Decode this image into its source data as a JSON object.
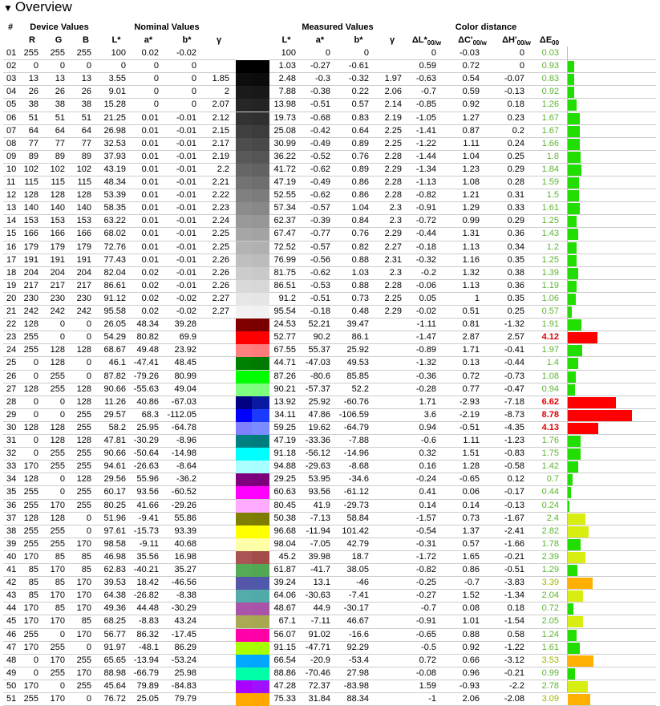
{
  "section": {
    "title": "Overview",
    "arrow": "▼"
  },
  "headers": {
    "index": "#",
    "device_values": "Device Values",
    "nominal_values": "Nominal Values",
    "measured_values": "Measured Values",
    "color_distance": "Color distance",
    "R": "R",
    "G": "G",
    "B": "B",
    "L": "L*",
    "a": "a*",
    "b": "b*",
    "gamma": "γ",
    "dL": "ΔL*",
    "dL_sub": "00/w",
    "dC": "ΔC'",
    "dC_sub": "00/w",
    "dH": "ΔH'",
    "dH_sub": "00/w",
    "dE": "ΔE",
    "dE_sub": "00"
  },
  "colors": {
    "de_green": "#5cb531",
    "de_yellow": "#a3b500",
    "de_red": "#e00000",
    "grid": "#cccccc"
  },
  "rows": [
    [
      "01",
      "255",
      "255",
      "255",
      "100",
      "0.02",
      "-0.02",
      "",
      "100",
      "0",
      "0",
      "",
      "0",
      "-0.03",
      "0",
      "0.03",
      "#ffffff",
      "#ffffff"
    ],
    [
      "02",
      "0",
      "0",
      "0",
      "0",
      "0",
      "0",
      "",
      "1.03",
      "-0.27",
      "-0.61",
      "",
      "0.59",
      "0.72",
      "0",
      "0.93",
      "#000000",
      "#000000"
    ],
    [
      "03",
      "13",
      "13",
      "13",
      "3.55",
      "0",
      "0",
      "1.85",
      "2.48",
      "-0.3",
      "-0.32",
      "1.97",
      "-0.63",
      "0.54",
      "-0.07",
      "0.83",
      "#0d0d0d",
      "#0b0b0b"
    ],
    [
      "04",
      "26",
      "26",
      "26",
      "9.01",
      "0",
      "0",
      "2",
      "7.88",
      "-0.38",
      "0.22",
      "2.06",
      "-0.7",
      "0.59",
      "-0.13",
      "0.92",
      "#1a1a1a",
      "#181818"
    ],
    [
      "05",
      "38",
      "38",
      "38",
      "15.28",
      "0",
      "0",
      "2.07",
      "13.98",
      "-0.51",
      "0.57",
      "2.14",
      "-0.85",
      "0.92",
      "0.18",
      "1.26",
      "#262626",
      "#232323"
    ],
    [
      "06",
      "51",
      "51",
      "51",
      "21.25",
      "0.01",
      "-0.01",
      "2.12",
      "19.73",
      "-0.68",
      "0.83",
      "2.19",
      "-1.05",
      "1.27",
      "0.23",
      "1.67",
      "#333333",
      "#303030"
    ],
    [
      "07",
      "64",
      "64",
      "64",
      "26.98",
      "0.01",
      "-0.01",
      "2.15",
      "25.08",
      "-0.42",
      "0.64",
      "2.25",
      "-1.41",
      "0.87",
      "0.2",
      "1.67",
      "#404040",
      "#3c3c3c"
    ],
    [
      "08",
      "77",
      "77",
      "77",
      "32.53",
      "0.01",
      "-0.01",
      "2.17",
      "30.99",
      "-0.49",
      "0.89",
      "2.25",
      "-1.22",
      "1.11",
      "0.24",
      "1.66",
      "#4d4d4d",
      "#494949"
    ],
    [
      "09",
      "89",
      "89",
      "89",
      "37.93",
      "0.01",
      "-0.01",
      "2.19",
      "36.22",
      "-0.52",
      "0.76",
      "2.28",
      "-1.44",
      "1.04",
      "0.25",
      "1.8",
      "#595959",
      "#555555"
    ],
    [
      "10",
      "102",
      "102",
      "102",
      "43.19",
      "0.01",
      "-0.01",
      "2.2",
      "41.72",
      "-0.62",
      "0.89",
      "2.29",
      "-1.34",
      "1.23",
      "0.29",
      "1.84",
      "#666666",
      "#626262"
    ],
    [
      "11",
      "115",
      "115",
      "115",
      "48.34",
      "0.01",
      "-0.01",
      "2.21",
      "47.19",
      "-0.49",
      "0.86",
      "2.28",
      "-1.13",
      "1.08",
      "0.28",
      "1.59",
      "#737373",
      "#6f6f6f"
    ],
    [
      "12",
      "128",
      "128",
      "128",
      "53.39",
      "0.01",
      "-0.01",
      "2.22",
      "52.55",
      "-0.62",
      "0.86",
      "2.28",
      "-0.82",
      "1.21",
      "0.31",
      "1.5",
      "#808080",
      "#7c7c7c"
    ],
    [
      "13",
      "140",
      "140",
      "140",
      "58.35",
      "0.01",
      "-0.01",
      "2.23",
      "57.34",
      "-0.57",
      "1.04",
      "2.3",
      "-0.91",
      "1.29",
      "0.33",
      "1.61",
      "#8c8c8c",
      "#888888"
    ],
    [
      "14",
      "153",
      "153",
      "153",
      "63.22",
      "0.01",
      "-0.01",
      "2.24",
      "62.37",
      "-0.39",
      "0.84",
      "2.3",
      "-0.72",
      "0.99",
      "0.29",
      "1.25",
      "#999999",
      "#969696"
    ],
    [
      "15",
      "166",
      "166",
      "166",
      "68.02",
      "0.01",
      "-0.01",
      "2.25",
      "67.47",
      "-0.77",
      "0.76",
      "2.29",
      "-0.44",
      "1.31",
      "0.36",
      "1.43",
      "#a6a6a6",
      "#a3a3a3"
    ],
    [
      "16",
      "179",
      "179",
      "179",
      "72.76",
      "0.01",
      "-0.01",
      "2.25",
      "72.52",
      "-0.57",
      "0.82",
      "2.27",
      "-0.18",
      "1.13",
      "0.34",
      "1.2",
      "#b3b3b3",
      "#b0b0b0"
    ],
    [
      "17",
      "191",
      "191",
      "191",
      "77.43",
      "0.01",
      "-0.01",
      "2.26",
      "76.99",
      "-0.56",
      "0.88",
      "2.31",
      "-0.32",
      "1.16",
      "0.35",
      "1.25",
      "#bfbfbf",
      "#bcbcbc"
    ],
    [
      "18",
      "204",
      "204",
      "204",
      "82.04",
      "0.02",
      "-0.01",
      "2.26",
      "81.75",
      "-0.62",
      "1.03",
      "2.3",
      "-0.2",
      "1.32",
      "0.38",
      "1.39",
      "#cccccc",
      "#c9c9c9"
    ],
    [
      "19",
      "217",
      "217",
      "217",
      "86.61",
      "0.02",
      "-0.01",
      "2.26",
      "86.51",
      "-0.53",
      "0.88",
      "2.28",
      "-0.06",
      "1.13",
      "0.36",
      "1.19",
      "#d9d9d9",
      "#d7d7d7"
    ],
    [
      "20",
      "230",
      "230",
      "230",
      "91.12",
      "0.02",
      "-0.02",
      "2.27",
      "91.2",
      "-0.51",
      "0.73",
      "2.25",
      "0.05",
      "1",
      "0.35",
      "1.06",
      "#e6e6e6",
      "#e5e5e5"
    ],
    [
      "21",
      "242",
      "242",
      "242",
      "95.58",
      "0.02",
      "-0.02",
      "2.27",
      "95.54",
      "-0.18",
      "0.48",
      "2.29",
      "-0.02",
      "0.51",
      "0.25",
      "0.57",
      "#f2f2f2",
      "#f1f1f1"
    ],
    [
      "22",
      "128",
      "0",
      "0",
      "26.05",
      "48.34",
      "39.28",
      "",
      "24.53",
      "52.21",
      "39.47",
      "",
      "-1.11",
      "0.81",
      "-1.32",
      "1.91",
      "#800000",
      "#7a0000"
    ],
    [
      "23",
      "255",
      "0",
      "0",
      "54.29",
      "80.82",
      "69.9",
      "",
      "52.77",
      "90.2",
      "86.1",
      "",
      "-1.47",
      "2.87",
      "2.57",
      "4.12",
      "#ff0000",
      "#ff0000"
    ],
    [
      "24",
      "255",
      "128",
      "128",
      "68.67",
      "49.48",
      "23.92",
      "",
      "67.55",
      "55.37",
      "25.92",
      "",
      "-0.89",
      "1.71",
      "-0.41",
      "1.97",
      "#ff8080",
      "#ff7a7a"
    ],
    [
      "25",
      "0",
      "128",
      "0",
      "46.1",
      "-47.41",
      "48.45",
      "",
      "44.71",
      "-47.03",
      "49.53",
      "",
      "-1.32",
      "0.13",
      "-0.44",
      "1.4",
      "#008000",
      "#007a00"
    ],
    [
      "26",
      "0",
      "255",
      "0",
      "87.82",
      "-79.26",
      "80.99",
      "",
      "87.26",
      "-80.6",
      "85.85",
      "",
      "-0.36",
      "0.72",
      "-0.73",
      "1.08",
      "#00ff00",
      "#00fe00"
    ],
    [
      "27",
      "128",
      "255",
      "128",
      "90.66",
      "-55.63",
      "49.04",
      "",
      "90.21",
      "-57.37",
      "52.2",
      "",
      "-0.28",
      "0.77",
      "-0.47",
      "0.94",
      "#80ff80",
      "#7dff7d"
    ],
    [
      "28",
      "0",
      "0",
      "128",
      "11.26",
      "40.86",
      "-67.03",
      "",
      "13.92",
      "25.92",
      "-60.76",
      "",
      "1.71",
      "-2.93",
      "-7.18",
      "6.62",
      "#000080",
      "#0a1aa0"
    ],
    [
      "29",
      "0",
      "0",
      "255",
      "29.57",
      "68.3",
      "-112.05",
      "",
      "34.11",
      "47.86",
      "-106.59",
      "",
      "3.6",
      "-2.19",
      "-8.73",
      "8.78",
      "#0000ff",
      "#1a3aff"
    ],
    [
      "30",
      "128",
      "128",
      "255",
      "58.2",
      "25.95",
      "-64.78",
      "",
      "59.25",
      "19.62",
      "-64.79",
      "",
      "0.94",
      "-0.51",
      "-4.35",
      "4.13",
      "#8080ff",
      "#7a8cff"
    ],
    [
      "31",
      "0",
      "128",
      "128",
      "47.81",
      "-30.29",
      "-8.96",
      "",
      "47.19",
      "-33.36",
      "-7.88",
      "",
      "-0.6",
      "1.11",
      "-1.23",
      "1.76",
      "#008080",
      "#007c7c"
    ],
    [
      "32",
      "0",
      "255",
      "255",
      "90.66",
      "-50.64",
      "-14.98",
      "",
      "91.18",
      "-56.12",
      "-14.96",
      "",
      "0.32",
      "1.51",
      "-0.83",
      "1.75",
      "#00ffff",
      "#00ffff"
    ],
    [
      "33",
      "170",
      "255",
      "255",
      "94.61",
      "-26.63",
      "-8.64",
      "",
      "94.88",
      "-29.63",
      "-8.68",
      "",
      "0.16",
      "1.28",
      "-0.58",
      "1.42",
      "#aaffff",
      "#a8ffff"
    ],
    [
      "34",
      "128",
      "0",
      "128",
      "29.56",
      "55.96",
      "-36.2",
      "",
      "29.25",
      "53.95",
      "-34.6",
      "",
      "-0.24",
      "-0.65",
      "0.12",
      "0.7",
      "#800080",
      "#7c007c"
    ],
    [
      "35",
      "255",
      "0",
      "255",
      "60.17",
      "93.56",
      "-60.52",
      "",
      "60.63",
      "93.56",
      "-61.12",
      "",
      "0.41",
      "0.06",
      "-0.17",
      "0.44",
      "#ff00ff",
      "#ff00ff"
    ],
    [
      "36",
      "255",
      "170",
      "255",
      "80.25",
      "41.66",
      "-29.26",
      "",
      "80.45",
      "41.9",
      "-29.73",
      "",
      "0.14",
      "0.14",
      "-0.13",
      "0.24",
      "#ffaaff",
      "#ffaaff"
    ],
    [
      "37",
      "128",
      "128",
      "0",
      "51.96",
      "-9.41",
      "55.86",
      "",
      "50.38",
      "-7.13",
      "58.84",
      "",
      "-1.57",
      "0.73",
      "-1.67",
      "2.4",
      "#808000",
      "#7c7c00"
    ],
    [
      "38",
      "255",
      "255",
      "0",
      "97.61",
      "-15.73",
      "93.39",
      "",
      "96.68",
      "-11.94",
      "101.42",
      "",
      "-0.54",
      "1.37",
      "-2.41",
      "2.82",
      "#ffff00",
      "#ffff00"
    ],
    [
      "39",
      "255",
      "255",
      "170",
      "98.58",
      "-9.11",
      "40.68",
      "",
      "98.04",
      "-7.05",
      "42.79",
      "",
      "-0.31",
      "0.57",
      "-1.66",
      "1.78",
      "#ffffaa",
      "#ffffa6"
    ],
    [
      "40",
      "170",
      "85",
      "85",
      "46.98",
      "35.56",
      "16.98",
      "",
      "45.2",
      "39.98",
      "18.7",
      "",
      "-1.72",
      "1.65",
      "-0.21",
      "2.39",
      "#aa5555",
      "#a44c4c"
    ],
    [
      "41",
      "85",
      "170",
      "85",
      "62.83",
      "-40.21",
      "35.27",
      "",
      "61.87",
      "-41.7",
      "38.05",
      "",
      "-0.82",
      "0.86",
      "-0.51",
      "1.29",
      "#55aa55",
      "#52a852"
    ],
    [
      "42",
      "85",
      "85",
      "170",
      "39.53",
      "18.42",
      "-46.56",
      "",
      "39.24",
      "13.1",
      "-46",
      "",
      "-0.25",
      "-0.7",
      "-3.83",
      "3.39",
      "#5555aa",
      "#5058aa"
    ],
    [
      "43",
      "85",
      "170",
      "170",
      "64.38",
      "-26.82",
      "-8.38",
      "",
      "64.06",
      "-30.63",
      "-7.41",
      "",
      "-0.27",
      "1.52",
      "-1.34",
      "2.04",
      "#55aaaa",
      "#50aaa8"
    ],
    [
      "44",
      "170",
      "85",
      "170",
      "49.36",
      "44.48",
      "-30.29",
      "",
      "48.67",
      "44.9",
      "-30.17",
      "",
      "-0.7",
      "0.08",
      "0.18",
      "0.72",
      "#aa55aa",
      "#a852a8"
    ],
    [
      "45",
      "170",
      "170",
      "85",
      "68.25",
      "-8.83",
      "43.24",
      "",
      "67.1",
      "-7.11",
      "46.67",
      "",
      "-0.91",
      "1.01",
      "-1.54",
      "2.05",
      "#aaaa55",
      "#a8a850"
    ],
    [
      "46",
      "255",
      "0",
      "170",
      "56.77",
      "86.32",
      "-17.45",
      "",
      "56.07",
      "91.02",
      "-16.6",
      "",
      "-0.65",
      "0.88",
      "0.58",
      "1.24",
      "#ff00aa",
      "#ff00a6"
    ],
    [
      "47",
      "170",
      "255",
      "0",
      "91.97",
      "-48.1",
      "86.29",
      "",
      "91.15",
      "-47.71",
      "92.29",
      "",
      "-0.5",
      "0.92",
      "-1.22",
      "1.61",
      "#aaff00",
      "#a6ff00"
    ],
    [
      "48",
      "0",
      "170",
      "255",
      "65.65",
      "-13.94",
      "-53.24",
      "",
      "66.54",
      "-20.9",
      "-53.4",
      "",
      "0.72",
      "0.66",
      "-3.12",
      "3.53",
      "#00aaff",
      "#00a6ff"
    ],
    [
      "49",
      "0",
      "255",
      "170",
      "88.98",
      "-66.79",
      "25.98",
      "",
      "88.86",
      "-70.46",
      "27.98",
      "",
      "-0.08",
      "0.96",
      "-0.21",
      "0.99",
      "#00ffaa",
      "#00ffa6"
    ],
    [
      "50",
      "170",
      "0",
      "255",
      "45.64",
      "79.89",
      "-84.83",
      "",
      "47.28",
      "72.37",
      "-83.98",
      "",
      "1.59",
      "-0.93",
      "-2.2",
      "2.78",
      "#aa00ff",
      "#9e10ff"
    ],
    [
      "51",
      "255",
      "170",
      "0",
      "76.72",
      "25.05",
      "79.79",
      "",
      "75.33",
      "31.84",
      "88.34",
      "",
      "-1",
      "2.06",
      "-2.08",
      "3.09",
      "#ffaa00",
      "#ffa600"
    ]
  ]
}
